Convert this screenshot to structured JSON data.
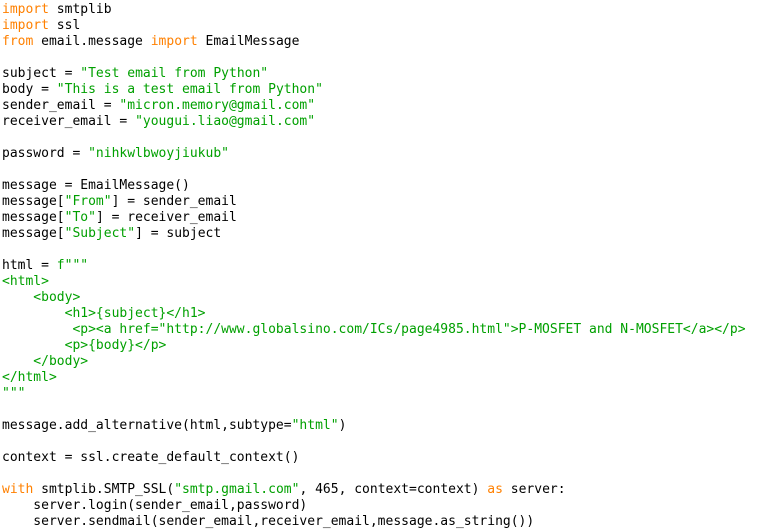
{
  "editor": {
    "language": "Python",
    "background_color": "#ffffff",
    "colors": {
      "plain": "#000000",
      "keyword": "#ff8000",
      "string": "#00a000"
    }
  },
  "code": {
    "lines": [
      {
        "id": "line-1",
        "tokens": [
          {
            "t": "import",
            "c": "keyword"
          },
          {
            "t": " smtplib",
            "c": "plain"
          }
        ]
      },
      {
        "id": "line-2",
        "tokens": [
          {
            "t": "import",
            "c": "keyword"
          },
          {
            "t": " ssl",
            "c": "plain"
          }
        ]
      },
      {
        "id": "line-3",
        "tokens": [
          {
            "t": "from",
            "c": "keyword"
          },
          {
            "t": " email.message ",
            "c": "plain"
          },
          {
            "t": "import",
            "c": "keyword"
          },
          {
            "t": " EmailMessage",
            "c": "plain"
          }
        ]
      },
      {
        "id": "line-4",
        "tokens": []
      },
      {
        "id": "line-5",
        "tokens": [
          {
            "t": "subject = ",
            "c": "plain"
          },
          {
            "t": "\"Test email from Python\"",
            "c": "string"
          }
        ]
      },
      {
        "id": "line-6",
        "tokens": [
          {
            "t": "body = ",
            "c": "plain"
          },
          {
            "t": "\"This is a test email from Python\"",
            "c": "string"
          }
        ]
      },
      {
        "id": "line-7",
        "tokens": [
          {
            "t": "sender_email = ",
            "c": "plain"
          },
          {
            "t": "\"micron.memory@gmail.com\"",
            "c": "string"
          }
        ]
      },
      {
        "id": "line-8",
        "tokens": [
          {
            "t": "receiver_email = ",
            "c": "plain"
          },
          {
            "t": "\"yougui.liao@gmail.com\"",
            "c": "string"
          }
        ]
      },
      {
        "id": "line-9",
        "tokens": []
      },
      {
        "id": "line-10",
        "tokens": [
          {
            "t": "password = ",
            "c": "plain"
          },
          {
            "t": "\"nihkwlbwoyjiukub\"",
            "c": "string"
          }
        ]
      },
      {
        "id": "line-11",
        "tokens": []
      },
      {
        "id": "line-12",
        "tokens": [
          {
            "t": "message = EmailMessage()",
            "c": "plain"
          }
        ]
      },
      {
        "id": "line-13",
        "tokens": [
          {
            "t": "message[",
            "c": "plain"
          },
          {
            "t": "\"From\"",
            "c": "string"
          },
          {
            "t": "] = sender_email",
            "c": "plain"
          }
        ]
      },
      {
        "id": "line-14",
        "tokens": [
          {
            "t": "message[",
            "c": "plain"
          },
          {
            "t": "\"To\"",
            "c": "string"
          },
          {
            "t": "] = receiver_email",
            "c": "plain"
          }
        ]
      },
      {
        "id": "line-15",
        "tokens": [
          {
            "t": "message[",
            "c": "plain"
          },
          {
            "t": "\"Subject\"",
            "c": "string"
          },
          {
            "t": "] = subject",
            "c": "plain"
          }
        ]
      },
      {
        "id": "line-16",
        "tokens": []
      },
      {
        "id": "line-17",
        "tokens": [
          {
            "t": "html = ",
            "c": "plain"
          },
          {
            "t": "f\"\"\"",
            "c": "string"
          }
        ]
      },
      {
        "id": "line-18",
        "tokens": [
          {
            "t": "<html>",
            "c": "string"
          }
        ]
      },
      {
        "id": "line-19",
        "tokens": [
          {
            "t": "    <body>",
            "c": "string"
          }
        ]
      },
      {
        "id": "line-20",
        "tokens": [
          {
            "t": "        <h1>{subject}</h1>",
            "c": "string"
          }
        ]
      },
      {
        "id": "line-21",
        "tokens": [
          {
            "t": "         <p><a href=\"http://www.globalsino.com/ICs/page4985.html\">P-MOSFET and N-MOSFET</a></p>",
            "c": "string"
          }
        ]
      },
      {
        "id": "line-22",
        "tokens": [
          {
            "t": "        <p>{body}</p>",
            "c": "string"
          }
        ]
      },
      {
        "id": "line-23",
        "tokens": [
          {
            "t": "    </body>",
            "c": "string"
          }
        ]
      },
      {
        "id": "line-24",
        "tokens": [
          {
            "t": "</html>",
            "c": "string"
          }
        ]
      },
      {
        "id": "line-25",
        "tokens": [
          {
            "t": "\"\"\"",
            "c": "string"
          }
        ]
      },
      {
        "id": "line-26",
        "tokens": []
      },
      {
        "id": "line-27",
        "tokens": [
          {
            "t": "message.add_alternative(html,subtype=",
            "c": "plain"
          },
          {
            "t": "\"html\"",
            "c": "string"
          },
          {
            "t": ")",
            "c": "plain"
          }
        ]
      },
      {
        "id": "line-28",
        "tokens": []
      },
      {
        "id": "line-29",
        "tokens": [
          {
            "t": "context = ssl.create_default_context()",
            "c": "plain"
          }
        ]
      },
      {
        "id": "line-30",
        "tokens": []
      },
      {
        "id": "line-31",
        "tokens": [
          {
            "t": "with",
            "c": "keyword"
          },
          {
            "t": " smtplib.SMTP_SSL(",
            "c": "plain"
          },
          {
            "t": "\"smtp.gmail.com\"",
            "c": "string"
          },
          {
            "t": ", 465, context=context) ",
            "c": "plain"
          },
          {
            "t": "as",
            "c": "keyword"
          },
          {
            "t": " server:",
            "c": "plain"
          }
        ]
      },
      {
        "id": "line-32",
        "tokens": [
          {
            "t": "    server.login(sender_email,password)",
            "c": "plain"
          }
        ]
      },
      {
        "id": "line-33",
        "tokens": [
          {
            "t": "    server.sendmail(sender_email,receiver_email,message.as_string())",
            "c": "plain"
          }
        ]
      }
    ]
  }
}
